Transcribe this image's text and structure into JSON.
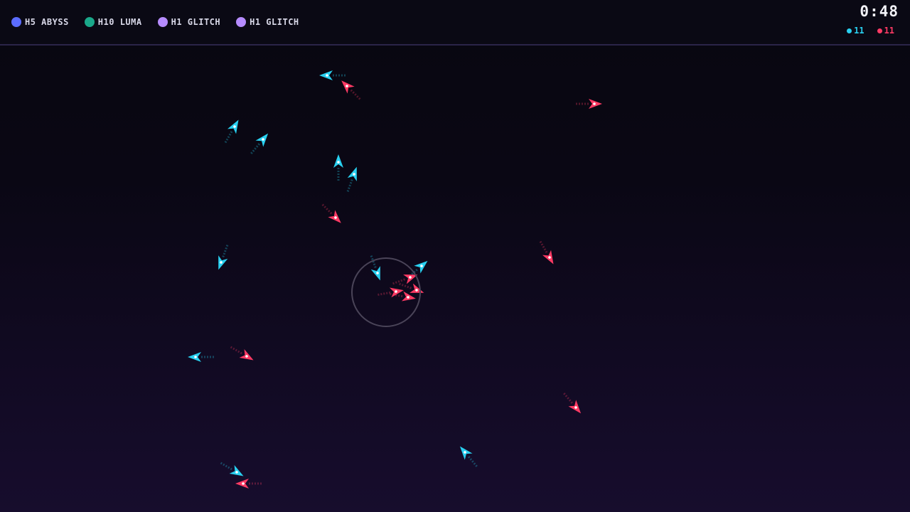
{
  "players": [
    {
      "label": "H5 ABYSS",
      "color": "#5b6cff"
    },
    {
      "label": "H10 LUMA",
      "color": "#1aa88a"
    },
    {
      "label": "H1 GLITCH",
      "color": "#b68cff"
    },
    {
      "label": "H1 GLITCH",
      "color": "#b68cff"
    }
  ],
  "timer": "0:48",
  "teams": {
    "cyan": {
      "count": "11",
      "color": "#29d0f0"
    },
    "red": {
      "count": "11",
      "color": "#ff3a64"
    }
  }
}
